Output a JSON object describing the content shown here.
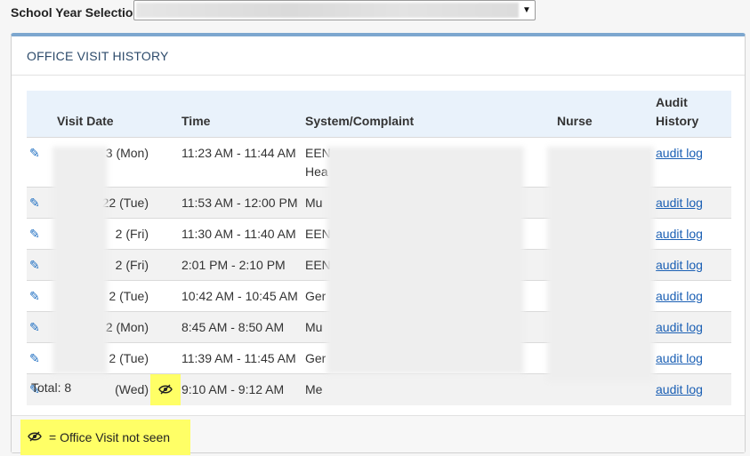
{
  "school_year": {
    "label": "School Year Selection:",
    "arrow_icon": "chevron-down-icon"
  },
  "panel": {
    "title": "OFFICE VISIT HISTORY",
    "columns": [
      "Visit Date",
      "Time",
      "System/Complaint",
      "Nurse",
      "Audit History"
    ],
    "rows": [
      {
        "date": "3 (Mon)",
        "time": "11:23 AM - 11:44 AM",
        "complaint": "EEN",
        "complaint2": "Hea",
        "audit": "audit log",
        "not_seen": false
      },
      {
        "date": "22 (Tue)",
        "time": "11:53 AM - 12:00 PM",
        "complaint": "Mu",
        "audit": "audit log",
        "not_seen": false
      },
      {
        "date": "2 (Fri)",
        "time": "11:30 AM - 11:40 AM",
        "complaint": "EEN",
        "audit": "audit log",
        "not_seen": false
      },
      {
        "date": "2 (Fri)",
        "time": "2:01 PM - 2:10 PM",
        "complaint": "EEN",
        "audit": "audit log",
        "not_seen": false
      },
      {
        "date": "2 (Tue)",
        "time": "10:42 AM - 10:45 AM",
        "complaint": "Ger",
        "audit": "audit log",
        "not_seen": false
      },
      {
        "date": "2 (Mon)",
        "time": "8:45 AM - 8:50 AM",
        "complaint": "Mu",
        "audit": "audit log",
        "not_seen": false
      },
      {
        "date": "2 (Tue)",
        "time": "11:39 AM - 11:45 AM",
        "complaint": "Ger",
        "audit": "audit log",
        "not_seen": false
      },
      {
        "date": "(Wed)",
        "time": "9:10 AM - 9:12 AM",
        "complaint": "Me",
        "audit": "audit log",
        "not_seen": true
      }
    ],
    "total": "Total: 8",
    "legend": "= Office Visit not seen",
    "edit_icon": "pencil-icon",
    "not_seen_icon": "eye-slash-icon",
    "highlight_color": "#ffff66",
    "link_color": "#1a5fb4"
  }
}
